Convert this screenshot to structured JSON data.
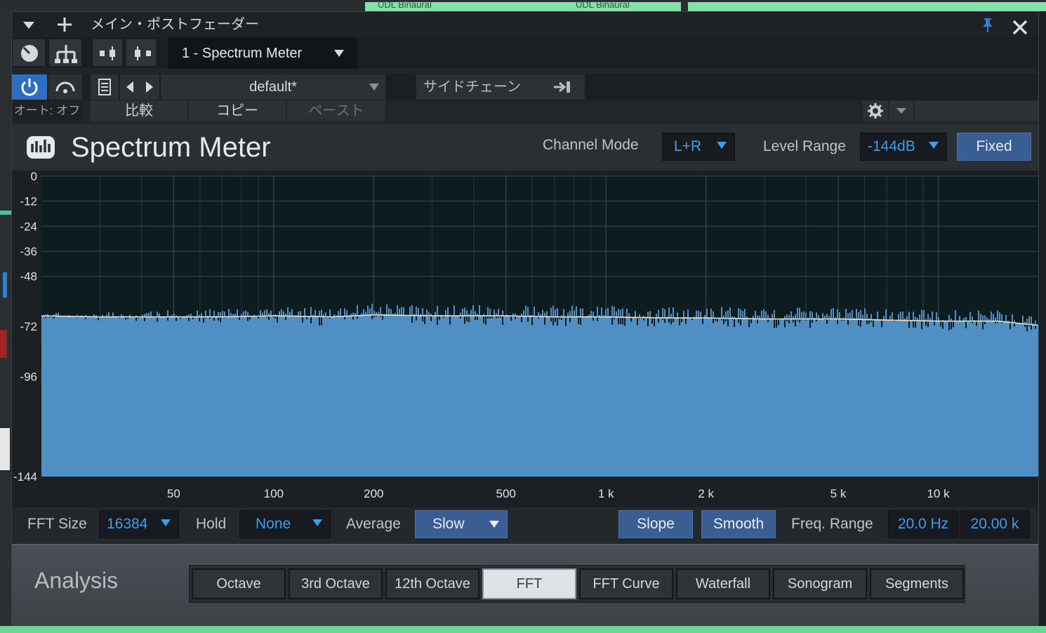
{
  "window": {
    "title": "メイン・ポストフェーダー",
    "menu_icon": "chevron-down-icon",
    "add_icon": "plus-icon",
    "pin_icon": "pin-icon",
    "close_icon": "close-icon"
  },
  "background": {
    "tab_labels": [
      "UDL Binaural",
      "UDL Binaural"
    ]
  },
  "toolbar": {
    "preset_name": "1 - Spectrum Meter",
    "program_name": "default*",
    "sidechain_label": "サイドチェーン",
    "automation_status": "オート: オフ",
    "compare_label": "比較",
    "copy_label": "コピー",
    "paste_label": "ペースト"
  },
  "plugin": {
    "name": "Spectrum Meter",
    "channel_mode_label": "Channel Mode",
    "channel_mode_value": "L+R",
    "level_range_label": "Level Range",
    "level_range_value": "-144dB",
    "fixed_label": "Fixed"
  },
  "controls": {
    "fft_size_label": "FFT Size",
    "fft_size_value": "16384",
    "hold_label": "Hold",
    "hold_value": "None",
    "average_label": "Average",
    "average_value": "Slow",
    "slope_label": "Slope",
    "smooth_label": "Smooth",
    "freq_range_label": "Freq. Range",
    "freq_min": "20.0 Hz",
    "freq_max": "20.00 k"
  },
  "analysis": {
    "label": "Analysis",
    "modes": [
      "Octave",
      "3rd Octave",
      "12th Octave",
      "FFT",
      "FFT Curve",
      "Waterfall",
      "Sonogram",
      "Segments"
    ],
    "active_mode": "FFT"
  },
  "colors": {
    "accent_blue": "#3f9ce8",
    "spectrum_fill": "#4f8fc4",
    "curve": "#f0e0c0",
    "active_button": "#3a5e93"
  },
  "chart_data": {
    "type": "area",
    "title": "",
    "xlabel": "",
    "ylabel": "",
    "x_scale": "log",
    "xlim": [
      20,
      20000
    ],
    "ylim": [
      -144,
      0
    ],
    "x_ticks": [
      50,
      100,
      200,
      500,
      1000,
      2000,
      5000,
      10000
    ],
    "x_tick_labels": [
      "50",
      "100",
      "200",
      "500",
      "1 k",
      "2 k",
      "5 k",
      "10 k"
    ],
    "y_ticks": [
      0,
      -12,
      -24,
      -36,
      -48,
      -72,
      -96,
      -144
    ],
    "y_tick_labels": [
      "0",
      "-12",
      "-24",
      "-36",
      "-48",
      "-72",
      "-96",
      "-144"
    ],
    "grid": true,
    "series": [
      {
        "x": [
          20,
          30,
          50,
          70,
          100,
          150,
          200,
          300,
          500,
          700,
          1000,
          1500,
          2000,
          3000,
          5000,
          7000,
          10000,
          15000,
          20000
        ],
        "values": [
          -67,
          -67.5,
          -67.5,
          -67.5,
          -67,
          -67.5,
          -66.5,
          -67,
          -67,
          -67.5,
          -67.5,
          -68,
          -68,
          -68.5,
          -68.5,
          -69,
          -69.5,
          -69.5,
          -71.5
        ]
      }
    ]
  }
}
